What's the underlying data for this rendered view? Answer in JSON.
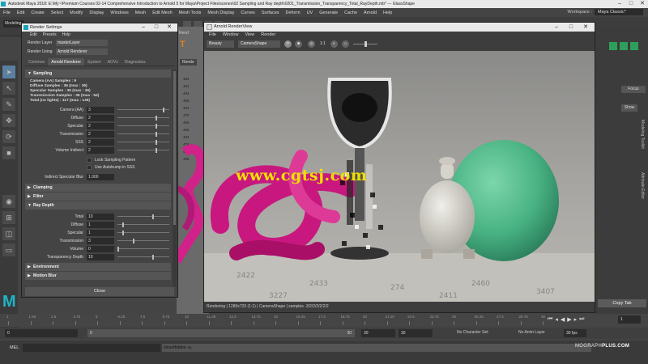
{
  "window": {
    "title": "Autodesk Maya 2018: E:\\My~\\Premium Courses 02-14 Comprehensive Introduction to Arnold 5 for Maya\\Project Files\\scenes\\02 Sampling and Ray depth\\0201_Transmission_Transparency_Total_RayDepth.mb* --- GlassShape"
  },
  "menubar": [
    "File",
    "Edit",
    "Create",
    "Select",
    "Modify",
    "Display",
    "Windows",
    "Mesh",
    "Edit Mesh",
    "Mesh Tools",
    "Mesh Display",
    "Curves",
    "Surfaces",
    "Deform",
    "UV",
    "Generate",
    "Cache",
    "Arnold",
    "Help"
  ],
  "workspace": {
    "label": "Workspace :",
    "value": "Maya Classic*"
  },
  "shelf": {
    "mode": "Modeling"
  },
  "viewport": {
    "tab": "Rend",
    "tab2": "Rende",
    "numbers": [
      "484",
      "464",
      "484",
      "465",
      "464",
      "476",
      "465",
      "465",
      "484",
      "476",
      "494",
      "466"
    ]
  },
  "render_settings": {
    "title": "Render Settings",
    "menu": [
      "Edit",
      "Presets",
      "Help"
    ],
    "render_layer_label": "Render Layer",
    "render_layer": "masterLayer",
    "render_using_label": "Render Using",
    "render_using": "Arnold Renderer",
    "tabs": [
      "Common",
      "Arnold Renderer",
      "System",
      "AOVs",
      "Diagnostics"
    ],
    "sections": {
      "sampling": "Sampling",
      "clamping": "Clamping",
      "filter": "Filter",
      "ray_depth": "Ray Depth",
      "environment": "Environment",
      "motion_blur": "Motion Blur"
    },
    "info": [
      "Camera (AA) Samples : 9",
      "Diffuse Samples : 36 (max : 36)",
      "Specular Samples : 36 (max : 36)",
      "Transmission Samples : 36 (max : 54)",
      "Total (no lights) : 117 (max : 135)"
    ],
    "sampling_params": [
      {
        "label": "Camera (AA)",
        "value": "3",
        "level": 0.9
      },
      {
        "label": "Diffuse",
        "value": "2",
        "level": 0.75
      },
      {
        "label": "Specular",
        "value": "2",
        "level": 0.75
      },
      {
        "label": "Transmission",
        "value": "2",
        "level": 0.75
      },
      {
        "label": "SSS",
        "value": "2",
        "level": 0.75
      },
      {
        "label": "Volume Indirect",
        "value": "2",
        "level": 0.75
      }
    ],
    "checks": [
      "Lock Sampling Pattern",
      "Use Autobump in SSS"
    ],
    "indirect_label": "Indirect Specular Blur",
    "indirect_value": "1.000",
    "ray_params": [
      {
        "label": "Total",
        "value": "10",
        "level": 0.7
      },
      {
        "label": "Diffuse",
        "value": "1",
        "level": 0.1
      },
      {
        "label": "Specular",
        "value": "1",
        "level": 0.1
      },
      {
        "label": "Transmission",
        "value": "3",
        "level": 0.3
      },
      {
        "label": "Volume",
        "value": "0",
        "level": 0.0
      },
      {
        "label": "Transparency Depth",
        "value": "10",
        "level": 0.7
      }
    ],
    "close": "Close"
  },
  "renderview": {
    "title": "Arnold RenderView",
    "menu": [
      "File",
      "Window",
      "View",
      "Render"
    ],
    "aov": "Beauty",
    "camera": "CameraShape",
    "ratio": "1:1",
    "status": "Rendering | 1280x720 (1:1) | CameraShape | samples -3/2/2/2/2/2/2",
    "watermark": "www.cgtsj.com"
  },
  "right_panel": {
    "focus": "Focus",
    "show": "Show",
    "attr_editor": "Attribute Editor",
    "modeling_toolkit": "Modeling Toolkit",
    "copy_tab": "Copy Tab"
  },
  "timeline": {
    "ticks": [
      "1",
      "1.25",
      "2.5",
      "3.75",
      "5",
      "6.25",
      "7.5",
      "8.75",
      "10",
      "11.25",
      "12.5",
      "13.75",
      "15",
      "16.25",
      "17.5",
      "18.75",
      "20",
      "21.25",
      "22.5",
      "23.75",
      "25",
      "26.25",
      "27.5",
      "28.75",
      "30"
    ],
    "current_frame": "1"
  },
  "range": {
    "start": "0",
    "inner_start": "0",
    "inner_end": "30",
    "end": "30",
    "end2": "30",
    "character_set": "No Character Set",
    "anim_layer": "No Anim Layer",
    "fps": "30 fps"
  },
  "cmdline": {
    "mel": "MEL",
    "result": "showHidden -a;"
  },
  "branding": {
    "maya_logo": "M",
    "motion": "MOGRAPH",
    "plus": "PLUS.COM"
  },
  "icons": {
    "shelf": "shelf-tool-icon",
    "select": "select-arrow-icon",
    "lasso": "lasso-icon",
    "paint": "paint-select-icon",
    "move": "move-icon",
    "rotate": "rotate-icon",
    "scale": "scale-icon"
  },
  "colors": {
    "maya_teal": "#19a3b5",
    "watermark": "#f0e000",
    "pink": "#d1228a",
    "green": "#3aa877"
  }
}
